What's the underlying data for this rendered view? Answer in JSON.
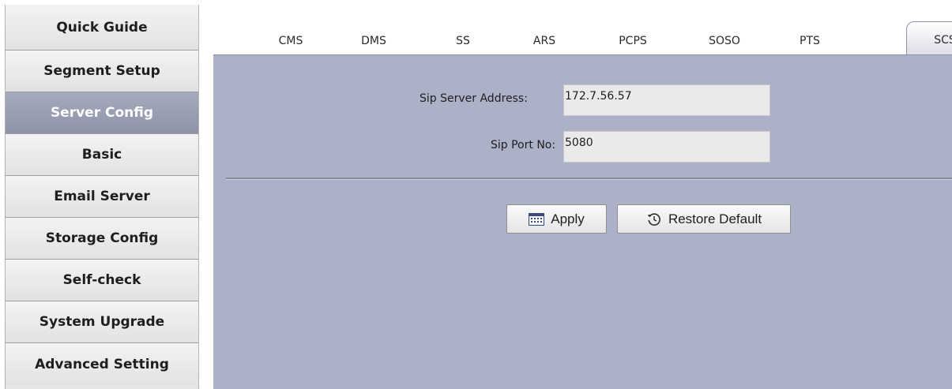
{
  "sidebar": {
    "items": [
      {
        "label": "Quick Guide"
      },
      {
        "label": "Segment Setup"
      },
      {
        "label": "Server Config"
      },
      {
        "label": "Basic"
      },
      {
        "label": "Email Server"
      },
      {
        "label": "Storage Config"
      },
      {
        "label": "Self-check"
      },
      {
        "label": "System Upgrade"
      },
      {
        "label": "Advanced Setting"
      }
    ],
    "active": "Server Config"
  },
  "tabs": [
    {
      "label": "CMS"
    },
    {
      "label": "DMS"
    },
    {
      "label": "SS"
    },
    {
      "label": "ARS"
    },
    {
      "label": "PCPS"
    },
    {
      "label": "SOSO"
    },
    {
      "label": "PTS"
    },
    {
      "label": "SCS"
    }
  ],
  "active_tab": "SCS",
  "form": {
    "sip_server_address": {
      "label": "Sip Server Address:",
      "value": "172.7.56.57"
    },
    "sip_port_no": {
      "label": "Sip Port No:",
      "value": "5080"
    }
  },
  "buttons": {
    "apply": {
      "label": "Apply",
      "icon": "calendar-grid-icon"
    },
    "restore_default": {
      "label": "Restore Default",
      "icon": "restore-clock-icon"
    }
  },
  "colors": {
    "panel": "#adb1c8",
    "nav_active": "#9a9fb3"
  }
}
